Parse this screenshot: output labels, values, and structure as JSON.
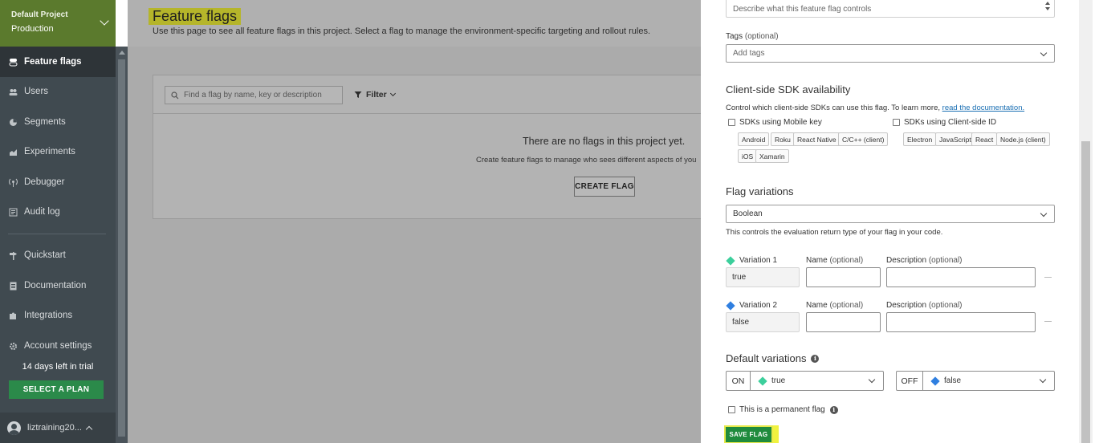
{
  "sidebar": {
    "project_name": "Default Project",
    "environment": "Production",
    "items": [
      {
        "label": "Feature flags",
        "icon": "toggle-icon"
      },
      {
        "label": "Users",
        "icon": "users-icon"
      },
      {
        "label": "Segments",
        "icon": "pie-icon"
      },
      {
        "label": "Experiments",
        "icon": "chart-icon"
      },
      {
        "label": "Debugger",
        "icon": "antenna-icon"
      },
      {
        "label": "Audit log",
        "icon": "log-icon"
      },
      {
        "label": "Quickstart",
        "icon": "signpost-icon"
      },
      {
        "label": "Documentation",
        "icon": "doc-icon"
      },
      {
        "label": "Integrations",
        "icon": "puzzle-icon"
      },
      {
        "label": "Account settings",
        "icon": "gear-icon"
      }
    ],
    "trial_text": "14 days left in trial",
    "plan_button": "SELECT A PLAN",
    "user_name": "liztraining20..."
  },
  "main": {
    "title": "Feature flags",
    "subtitle": "Use this page to see all feature flags in this project. Select a flag to manage the environment-specific targeting and rollout rules.",
    "search_placeholder": "Find a flag by name, key or description",
    "filter_label": "Filter",
    "empty_title": "There are no flags in this project yet.",
    "empty_desc": "Create feature flags to manage who sees different aspects of you",
    "create_button": "CREATE FLAG"
  },
  "drawer": {
    "description_placeholder": "Describe what this feature flag controls",
    "tags_label": "Tags",
    "optional": "(optional)",
    "tags_placeholder": "Add tags",
    "sdk_heading": "Client-side SDK availability",
    "sdk_help": "Control which client-side SDKs can use this flag. To learn more, ",
    "sdk_help_link": "read the documentation.",
    "mobile_label": "SDKs using Mobile key",
    "mobile_chips": [
      "Android",
      "Roku",
      "React Native",
      "C/C++ (client)",
      "iOS",
      "Xamarin"
    ],
    "clientid_label": "SDKs using Client-side ID",
    "clientid_chips": [
      "Electron",
      "JavaScript",
      "React",
      "Node.js (client)"
    ],
    "variations_heading": "Flag variations",
    "variation_type": "Boolean",
    "variation_help": "This controls the evaluation return type of your flag in your code.",
    "variation1_label": "Variation 1",
    "variation1_value": "true",
    "variation2_label": "Variation 2",
    "variation2_value": "false",
    "name_label": "Name",
    "description_label": "Description",
    "default_heading": "Default variations",
    "on_label": "ON",
    "on_value": "true",
    "off_label": "OFF",
    "off_value": "false",
    "permanent_label": "This is a permanent flag",
    "save_button": "SAVE FLAG",
    "colors": {
      "true_diamond": "#3ccf9c",
      "false_diamond": "#2f7fe0",
      "save": "#1f8b3d",
      "highlight": "#f0f23f"
    }
  }
}
